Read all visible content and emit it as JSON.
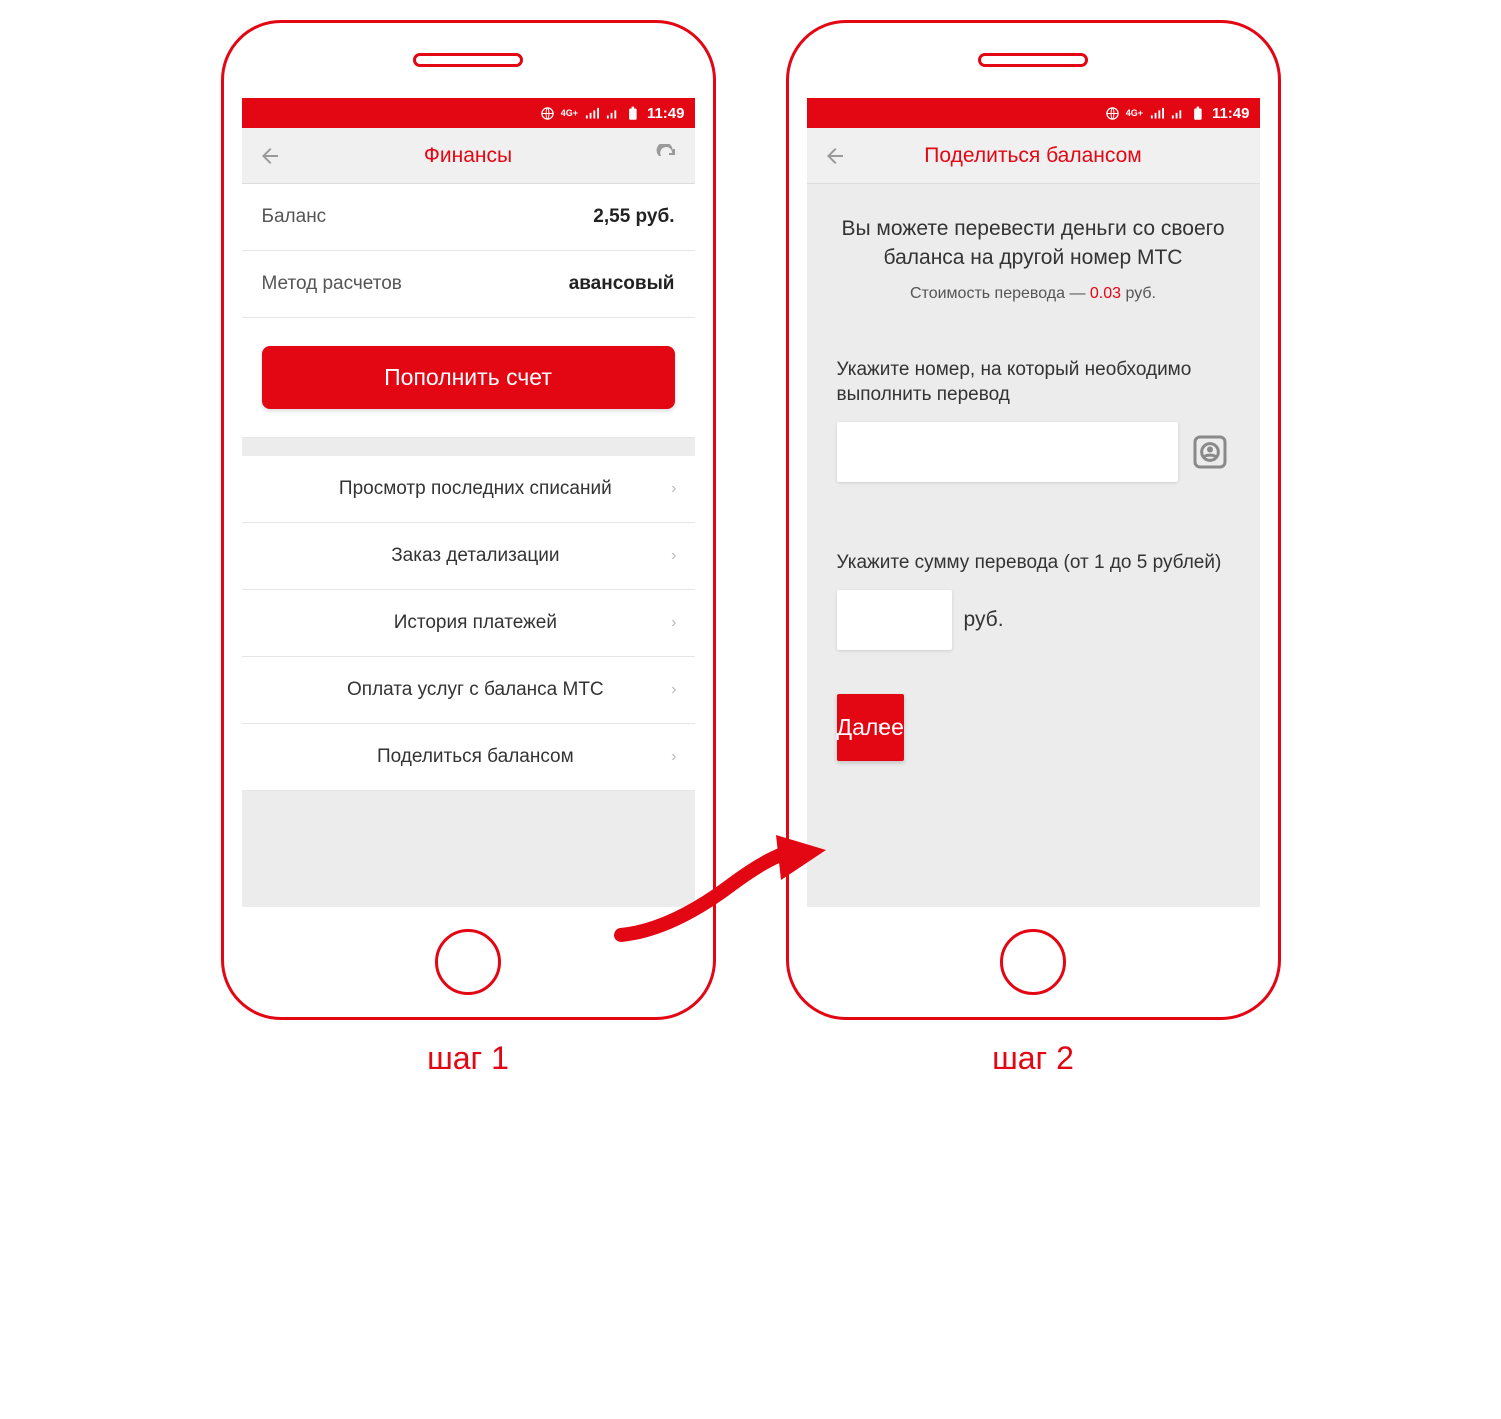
{
  "status": {
    "time": "11:49"
  },
  "step_labels": {
    "s1": "шаг 1",
    "s2": "шаг 2"
  },
  "screen1": {
    "title": "Финансы",
    "balance_label": "Баланс",
    "balance_value": "2,55 руб.",
    "method_label": "Метод расчетов",
    "method_value": "авансовый",
    "topup": "Пополнить счет",
    "items": [
      "Просмотр последних списаний",
      "Заказ детализации",
      "История платежей",
      "Оплата услуг c баланса МТС",
      "Поделиться балансом"
    ]
  },
  "screen2": {
    "title": "Поделиться балансом",
    "info_main": "Вы можете перевести деньги со своего баланса на другой номер МТС",
    "cost_prefix": "Стоимость перевода — ",
    "cost_value": "0.03",
    "cost_suffix": " руб.",
    "number_label": "Укажите номер, на который необходимо выполнить перевод",
    "amount_label": "Укажите сумму перевода (от 1 до 5 рублей)",
    "amount_unit": "руб.",
    "next": "Далее"
  }
}
